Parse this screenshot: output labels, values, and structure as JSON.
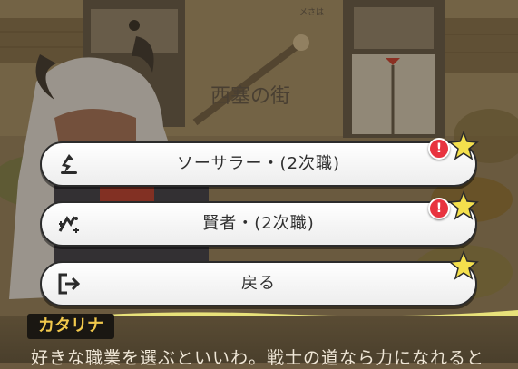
{
  "background": {
    "town_sign": "西塞の街",
    "top_sign": "メさは"
  },
  "choices": [
    {
      "label": "ソーサラー・(2次職)",
      "icon": "sorcerer-class-icon",
      "has_alert": true,
      "alert_text": "!"
    },
    {
      "label": "賢者・(2次職)",
      "icon": "sage-class-icon",
      "has_alert": true,
      "alert_text": "!"
    },
    {
      "label": "戻る",
      "icon": "exit-icon",
      "has_alert": false
    }
  ],
  "dialog": {
    "speaker": "カタリナ",
    "text": "好きな職業を選ぶといいわ。戦士の道なら力になれると"
  },
  "colors": {
    "button_bg": "#ffffff",
    "alert_red": "#e8333f",
    "star_yellow": "#f4e04d",
    "name_text": "#f2c94c"
  }
}
